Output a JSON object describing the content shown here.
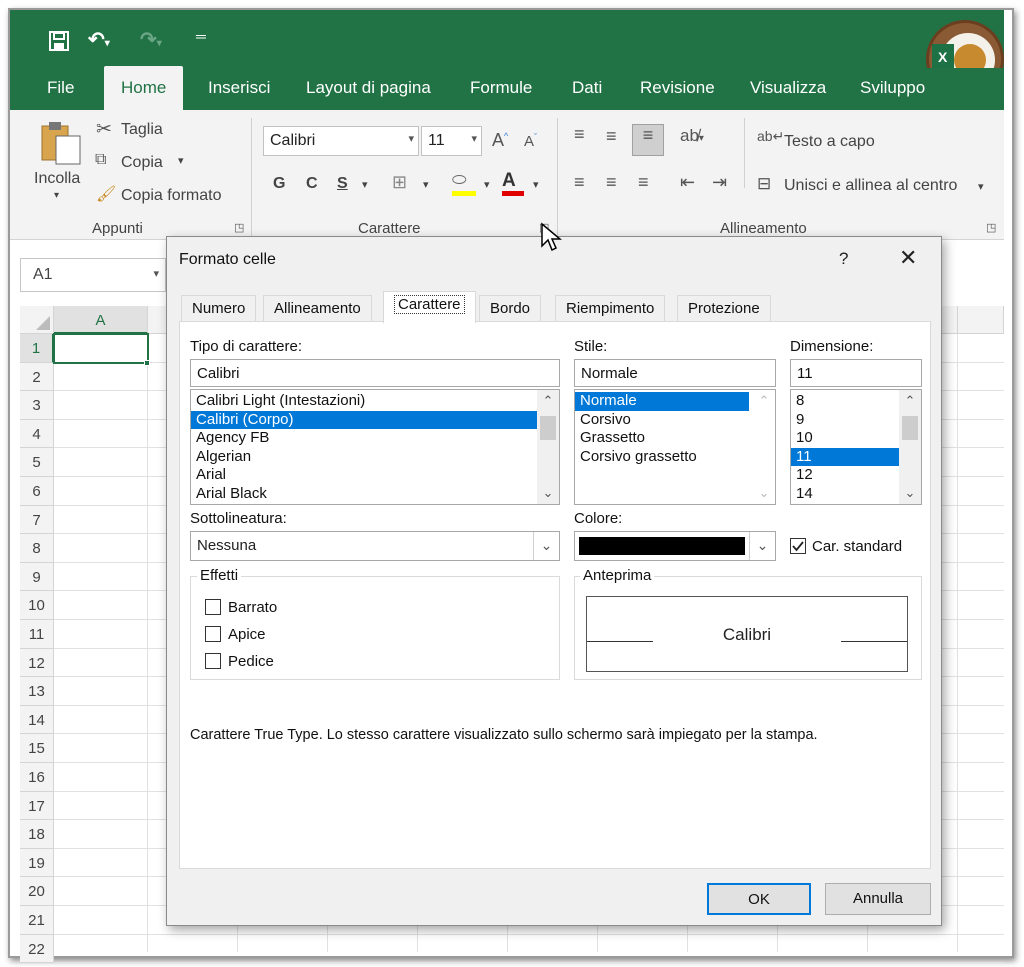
{
  "ribbon_tabs": [
    "File",
    "Home",
    "Inserisci",
    "Layout di pagina",
    "Formule",
    "Dati",
    "Revisione",
    "Visualizza",
    "Sviluppo"
  ],
  "clipboard": {
    "paste": "Incolla",
    "cut": "Taglia",
    "copy": "Copia",
    "format_painter": "Copia formato",
    "group": "Appunti"
  },
  "font_group": {
    "font": "Calibri",
    "size": "11",
    "bold": "G",
    "italic": "C",
    "underline": "S",
    "group": "Carattere"
  },
  "align_group": {
    "wrap": "Testo a capo",
    "merge": "Unisci e allinea al centro",
    "group": "Allineamento"
  },
  "name_box": "A1",
  "columns": [
    "A"
  ],
  "rows": [
    "1",
    "2",
    "3",
    "4",
    "5",
    "6",
    "7",
    "8",
    "9",
    "10",
    "11",
    "12",
    "13",
    "14",
    "15",
    "16",
    "17",
    "18",
    "19",
    "20",
    "21",
    "22"
  ],
  "dialog": {
    "title": "Formato celle",
    "help": "?",
    "tabs": [
      "Numero",
      "Allineamento",
      "Carattere",
      "Bordo",
      "Riempimento",
      "Protezione"
    ],
    "font_label": "Tipo di carattere:",
    "font_value": "Calibri",
    "fonts": [
      "Calibri Light (Intestazioni)",
      "Calibri (Corpo)",
      "Agency FB",
      "Algerian",
      "Arial",
      "Arial Black"
    ],
    "style_label": "Stile:",
    "style_value": "Normale",
    "styles": [
      "Normale",
      "Corsivo",
      "Grassetto",
      "Corsivo grassetto"
    ],
    "size_label": "Dimensione:",
    "size_value": "11",
    "sizes": [
      "8",
      "9",
      "10",
      "11",
      "12",
      "14"
    ],
    "underline_label": "Sottolineatura:",
    "underline_value": "Nessuna",
    "color_label": "Colore:",
    "color_value": "#000000",
    "normal_font": "Car. standard",
    "effects_label": "Effetti",
    "strike": "Barrato",
    "super": "Apice",
    "sub": "Pedice",
    "preview_label": "Anteprima",
    "preview_text": "Calibri",
    "info": "Carattere True Type. Lo stesso carattere visualizzato sullo schermo sarà impiegato per la stampa.",
    "ok": "OK",
    "cancel": "Annulla"
  },
  "colors": {
    "excel_green": "#217346",
    "selection": "#0078d7"
  }
}
